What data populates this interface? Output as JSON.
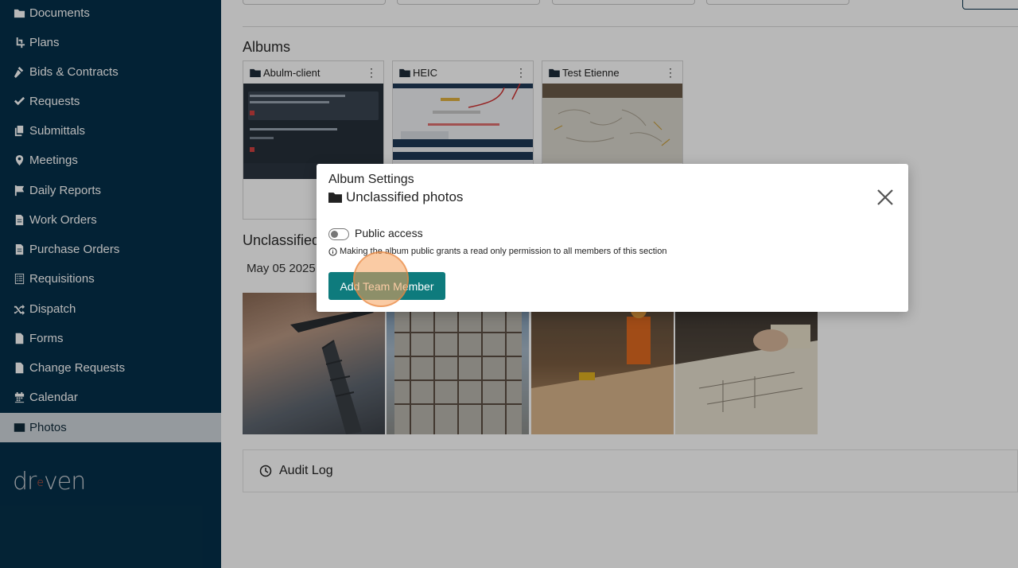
{
  "sidebar": {
    "items": [
      {
        "label": "Documents",
        "icon": "folder-icon"
      },
      {
        "label": "Plans",
        "icon": "crop-icon"
      },
      {
        "label": "Bids & Contracts",
        "icon": "gavel-icon"
      },
      {
        "label": "Requests",
        "icon": "check-icon"
      },
      {
        "label": "Submittals",
        "icon": "copy-icon"
      },
      {
        "label": "Meetings",
        "icon": "map-pin-icon"
      },
      {
        "label": "Daily Reports",
        "icon": "flag-icon"
      },
      {
        "label": "Work Orders",
        "icon": "file-text-icon"
      },
      {
        "label": "Purchase Orders",
        "icon": "file-text-icon"
      },
      {
        "label": "Requisitions",
        "icon": "list-alt-icon"
      },
      {
        "label": "Dispatch",
        "icon": "shuffle-icon"
      },
      {
        "label": "Forms",
        "icon": "file-lines-icon"
      },
      {
        "label": "Change Requests",
        "icon": "file-icon"
      },
      {
        "label": "Calendar",
        "icon": "calendar-icon"
      },
      {
        "label": "Photos",
        "icon": "image-icon",
        "active": true
      }
    ],
    "logo": {
      "left": "dr",
      "middle": "e",
      "right": "ven"
    }
  },
  "main": {
    "albums_title": "Albums",
    "albums": [
      {
        "name": "Abulm-client"
      },
      {
        "name": "HEIC"
      },
      {
        "name": "Test Etienne"
      }
    ],
    "unclassified_title": "Unclassified",
    "date_label": "May 05 2025",
    "audit_log_label": "Audit Log"
  },
  "modal": {
    "title": "Album Settings",
    "album_name": "Unclassified photos",
    "public_access_label": "Public access",
    "public_access_enabled": false,
    "info_text": "Making the album public grants a read only permission to all members of this section",
    "add_button_label": "Add Team Member"
  },
  "colors": {
    "sidebar_bg": "#05304a",
    "accent_teal": "#0e7b7d",
    "active_item_bg": "#cfd6dc"
  }
}
